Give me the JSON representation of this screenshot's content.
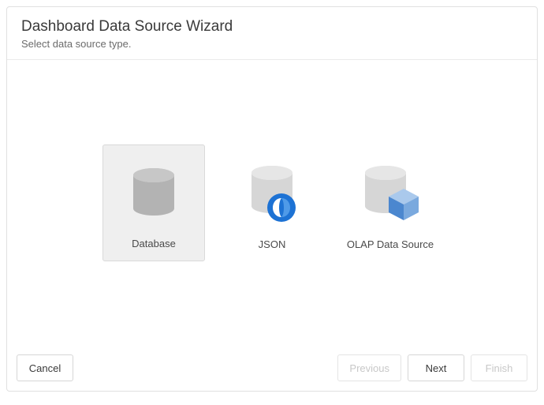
{
  "header": {
    "title": "Dashboard Data Source Wizard",
    "subtitle": "Select data source type."
  },
  "options": {
    "database": {
      "label": "Database",
      "selected": true
    },
    "json": {
      "label": "JSON",
      "selected": false
    },
    "olap": {
      "label": "OLAP Data Source",
      "selected": false
    }
  },
  "footer": {
    "cancel": "Cancel",
    "previous": "Previous",
    "next": "Next",
    "finish": "Finish"
  }
}
